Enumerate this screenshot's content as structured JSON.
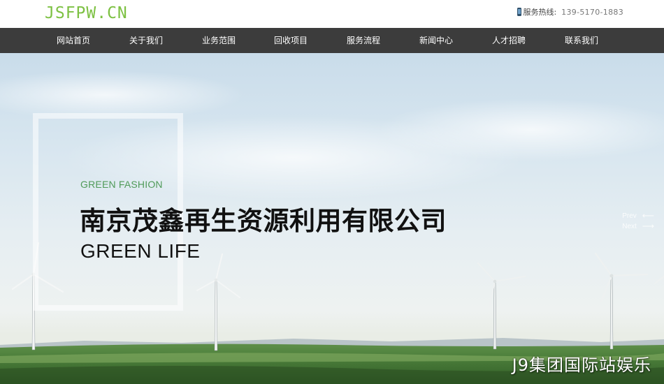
{
  "header": {
    "logo_text": "JSFPW.CN",
    "hotline_label": "服务热线:",
    "hotline_number": "139-5170-1883"
  },
  "nav": {
    "items": [
      {
        "label": "网站首页"
      },
      {
        "label": "关于我们"
      },
      {
        "label": "业务范围"
      },
      {
        "label": "回收项目"
      },
      {
        "label": "服务流程"
      },
      {
        "label": "新闻中心"
      },
      {
        "label": "人才招聘"
      },
      {
        "label": "联系我们"
      }
    ]
  },
  "banner": {
    "eyebrow": "GREEN FASHION",
    "headline": "南京茂鑫再生资源利用有限公司",
    "subhead": "GREEN LIFE",
    "prev_label": "Prev",
    "next_label": "Next",
    "prev_arrow": "⟵",
    "next_arrow": "⟶"
  },
  "watermark": "J9集团国际站娱乐",
  "colors": {
    "logo": "#7dc143",
    "nav_bg": "#3c3c3c",
    "eyebrow": "#4f9a58"
  }
}
